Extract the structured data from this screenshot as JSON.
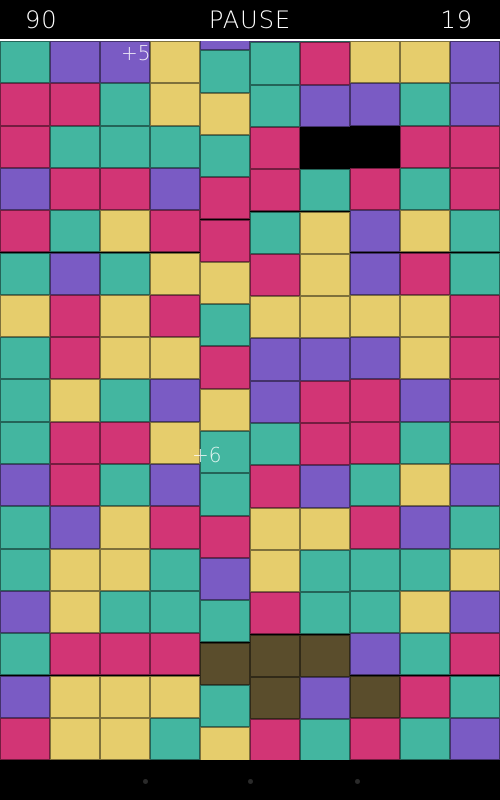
{
  "header": {
    "score": "90",
    "pause_label": "PAUSE",
    "moves": "19"
  },
  "colors": {
    "P": "#d23575",
    "T": "#43b6a0",
    "V": "#7a5bc4",
    "Y": "#e6cd6c",
    "K": "#000000",
    "D": "#5a4d2c",
    "dark_purple": "#5c3c8c"
  },
  "board": {
    "columns": [
      [
        "T",
        "P",
        "P",
        "V",
        "P",
        "T",
        "Y",
        "T",
        "T",
        "T",
        "V",
        "T",
        "T",
        "V",
        "T",
        "V",
        "P"
      ],
      [
        "V",
        "P",
        "T",
        "P",
        "T",
        "V",
        "P",
        "P",
        "Y",
        "P",
        "P",
        "V",
        "Y",
        "Y",
        "P",
        "Y",
        "Y"
      ],
      [
        "V",
        "T",
        "T",
        "P",
        "Y",
        "T",
        "Y",
        "Y",
        "T",
        "P",
        "T",
        "Y",
        "Y",
        "T",
        "P",
        "Y",
        "Y"
      ],
      [
        "Y",
        "Y",
        "T",
        "V",
        "P",
        "Y",
        "P",
        "Y",
        "V",
        "Y",
        "V",
        "P",
        "T",
        "T",
        "P",
        "Y",
        "T"
      ],
      [
        "V",
        "T",
        "Y",
        "T",
        "P",
        "P",
        "Y",
        "T",
        "P",
        "Y",
        "T",
        "T",
        "P",
        "V",
        "T",
        "D",
        "T",
        "Y"
      ],
      [
        "V",
        "T",
        "T",
        "P",
        "P",
        "T",
        "P",
        "Y",
        "V",
        "V",
        "T",
        "P",
        "Y",
        "Y",
        "P",
        "D",
        "D",
        "P"
      ],
      [
        "T",
        "P",
        "V",
        "K",
        "T",
        "Y",
        "Y",
        "Y",
        "V",
        "P",
        "P",
        "V",
        "Y",
        "T",
        "T",
        "D",
        "V",
        "T"
      ],
      [
        "Y",
        "V",
        "K",
        "P",
        "V",
        "V",
        "Y",
        "V",
        "P",
        "P",
        "T",
        "P",
        "T",
        "T",
        "V",
        "D",
        "P",
        "P"
      ],
      [
        "Y",
        "T",
        "P",
        "T",
        "Y",
        "P",
        "Y",
        "Y",
        "V",
        "T",
        "Y",
        "V",
        "T",
        "Y",
        "T",
        "P",
        "T"
      ],
      [
        "V",
        "V",
        "P",
        "P",
        "T",
        "T",
        "P",
        "P",
        "P",
        "P",
        "V",
        "T",
        "Y",
        "V",
        "P",
        "T",
        "V"
      ]
    ]
  },
  "popups": [
    {
      "text": "+5"
    },
    {
      "text": "+6"
    }
  ]
}
